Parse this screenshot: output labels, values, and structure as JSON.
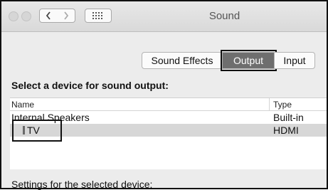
{
  "window": {
    "title": "Sound"
  },
  "toolbar": {
    "back_icon": "chevron-left-icon",
    "forward_icon": "chevron-right-icon",
    "grid_icon": "show-all-grid-icon"
  },
  "tabs": [
    {
      "label": "Sound Effects",
      "selected": false
    },
    {
      "label": "Output",
      "selected": true
    },
    {
      "label": "Input",
      "selected": false
    }
  ],
  "output": {
    "heading": "Select a device for sound output:",
    "columns": {
      "name": "Name",
      "type": "Type"
    },
    "devices": [
      {
        "name": "Internal Speakers",
        "type": "Built-in",
        "selected": false
      },
      {
        "name": "TV",
        "type": "HDMI",
        "selected": true
      }
    ],
    "settings_label": "Settings for the selected device:"
  },
  "colors": {
    "selected_tab_bg": "#6e6e6e",
    "selected_row_bg": "#d7d7d7",
    "annotation_border": "#111111"
  }
}
